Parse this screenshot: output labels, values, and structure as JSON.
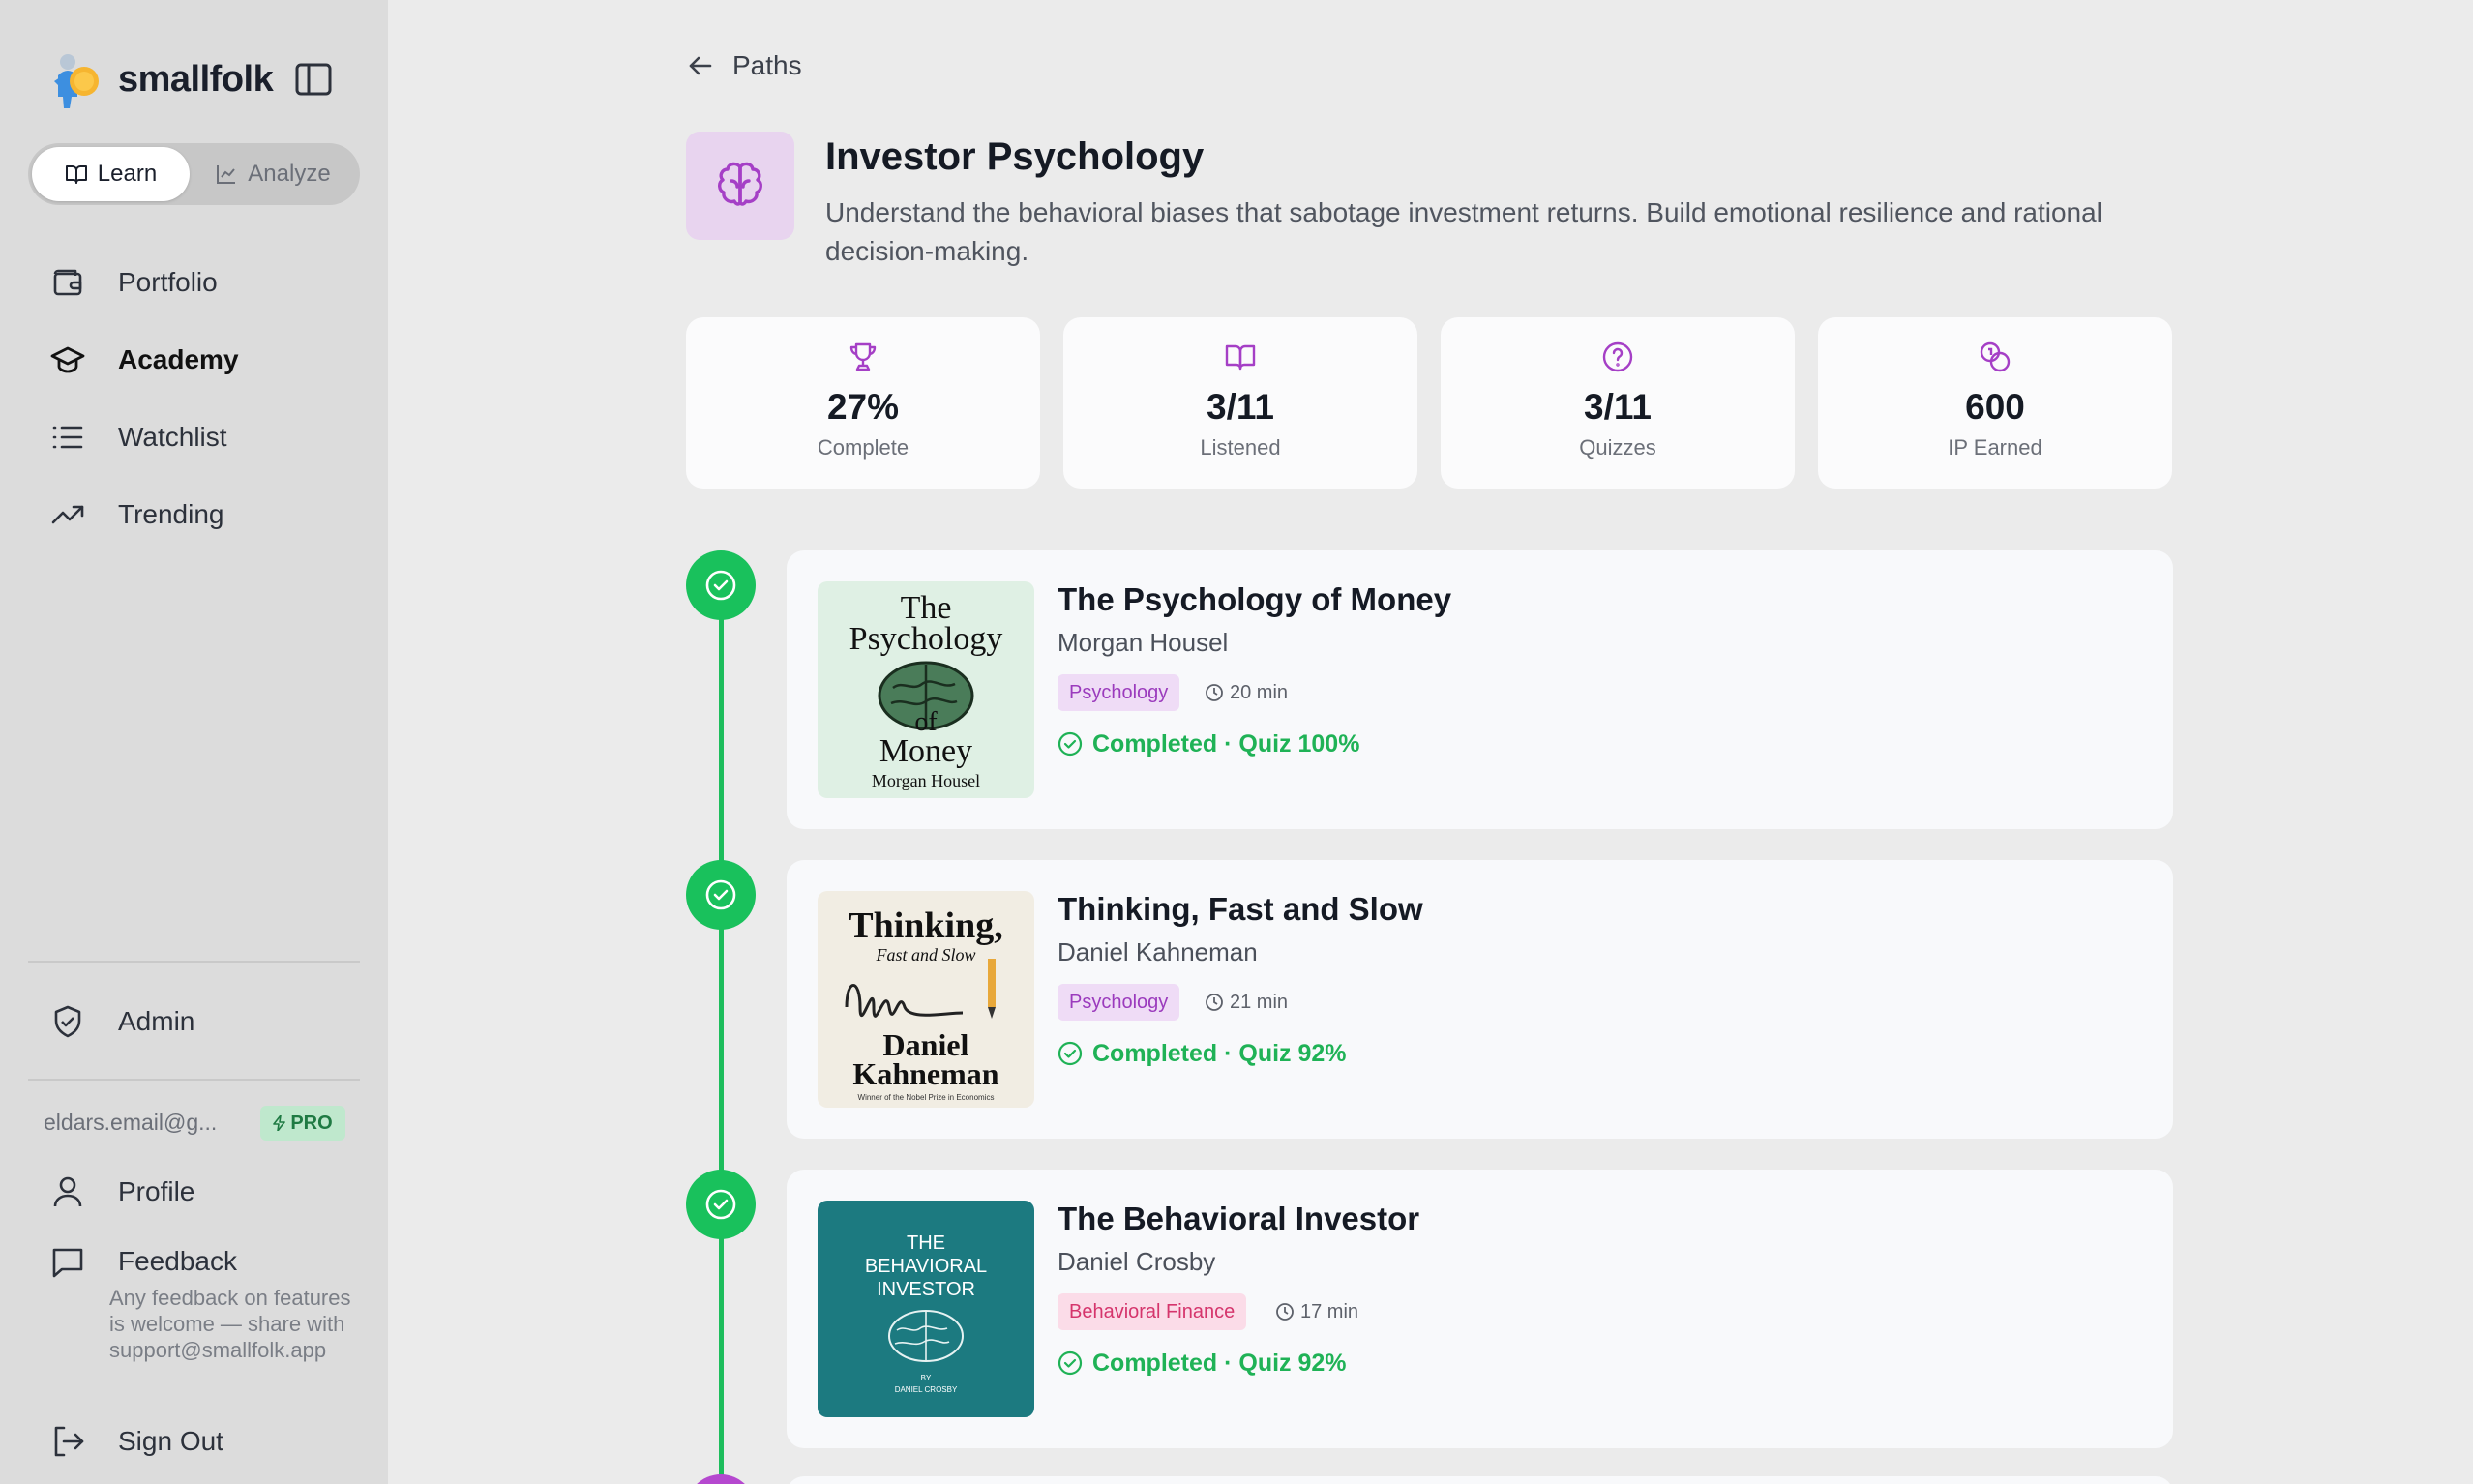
{
  "app": {
    "name": "smallfolk"
  },
  "mode_toggle": {
    "learn": "Learn",
    "analyze": "Analyze"
  },
  "nav": [
    {
      "label": "Portfolio",
      "icon": "wallet-icon"
    },
    {
      "label": "Academy",
      "icon": "graduation-cap-icon",
      "active": true
    },
    {
      "label": "Watchlist",
      "icon": "list-icon"
    },
    {
      "label": "Trending",
      "icon": "trending-up-icon"
    }
  ],
  "admin": {
    "label": "Admin"
  },
  "user": {
    "email": "eldars.email@g...",
    "plan": "PRO"
  },
  "footer": {
    "profile": "Profile",
    "feedback": "Feedback",
    "feedback_note": "Any feedback on features is welcome — share with support@smallfolk.app",
    "sign_out": "Sign Out"
  },
  "back": {
    "label": "Paths"
  },
  "path": {
    "title": "Investor Psychology",
    "description": "Understand the behavioral biases that sabotage investment returns. Build emotional resilience and rational decision-making."
  },
  "stats": [
    {
      "value": "27%",
      "label": "Complete",
      "icon": "trophy-icon"
    },
    {
      "value": "3/11",
      "label": "Listened",
      "icon": "book-open-icon"
    },
    {
      "value": "3/11",
      "label": "Quizzes",
      "icon": "help-circle-icon"
    },
    {
      "value": "600",
      "label": "IP Earned",
      "icon": "coins-icon"
    }
  ],
  "books": [
    {
      "title": "The Psychology of Money",
      "author": "Morgan Housel",
      "tag": "Psychology",
      "duration": "20 min",
      "status": "Completed · Quiz 100%",
      "cover": {
        "line1": "The",
        "line2": "Psychology",
        "line3": "of",
        "line4": "Money",
        "author": "Morgan Housel"
      }
    },
    {
      "title": "Thinking, Fast and Slow",
      "author": "Daniel Kahneman",
      "tag": "Psychology",
      "duration": "21 min",
      "status": "Completed · Quiz 92%",
      "cover": {
        "line1": "Thinking,",
        "line2": "Fast and Slow",
        "line3": "Daniel",
        "line4": "Kahneman",
        "author": "Winner of the Nobel Prize in Economics"
      }
    },
    {
      "title": "The Behavioral Investor",
      "author": "Daniel Crosby",
      "tag": "Behavioral Finance",
      "duration": "17 min",
      "status": "Completed · Quiz 92%",
      "cover": {
        "line1": "THE",
        "line2": "BEHAVIORAL",
        "line3": "INVESTOR",
        "line4": "BY",
        "author": "DANIEL CROSBY"
      }
    }
  ],
  "colors": {
    "accent_green": "#19c15c",
    "psychology_tag": "#9b3bbd",
    "behavioral_tag": "#d5356c",
    "path_icon_bg": "#e8d4ef"
  }
}
